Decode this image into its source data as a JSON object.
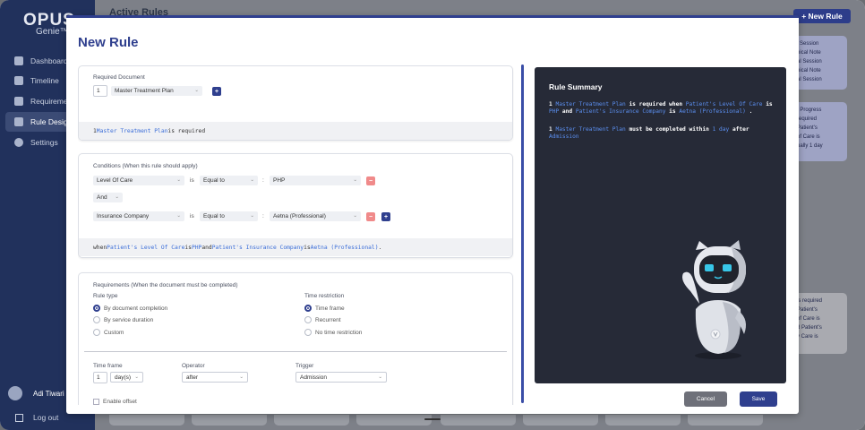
{
  "colors": {
    "accent": "#2f3f8e",
    "sidebar": "#21315c",
    "panel": "#262a37",
    "highlight": "#3a6dd8",
    "danger": "#f08a8a"
  },
  "sidebar": {
    "logo": "OPUS",
    "logo_sub": "Genie™",
    "items": [
      {
        "label": "Dashboard",
        "icon": "dashboard-icon"
      },
      {
        "label": "Timeline",
        "icon": "timeline-icon"
      },
      {
        "label": "Requirements",
        "icon": "requirements-icon"
      },
      {
        "label": "Rule Design",
        "icon": "rule-design-icon",
        "active": true
      },
      {
        "label": "Settings",
        "icon": "gear-icon"
      }
    ],
    "user": "Adi Tiwari",
    "logout": "Log out"
  },
  "background": {
    "page_title": "Active Rules",
    "new_rule_button": "+ New Rule",
    "card1": "l Session\nnical Note\nal Session\nnical Note\nal Session",
    "card2": "f Progress\nrequired\nPatient's\nof Care is\nually 1 day",
    "card3": "is required\nPatient's\nof Care is\nd Patient's\ny Care is"
  },
  "modal": {
    "title": "New Rule",
    "required_document": {
      "label": "Required Document",
      "quantity": "1",
      "document": "Master Treatment Plan",
      "add_button": "+",
      "summary": {
        "qty": "1",
        "doc": "Master Treatment Plan",
        "rest": "is required"
      }
    },
    "conditions": {
      "label": "Conditions (When this rule should apply)",
      "row1": {
        "field": "Level Of Care",
        "is": "is",
        "operator": "Equal to",
        "sep": ":",
        "value": "PHP",
        "remove": "−"
      },
      "joiner": "And",
      "row2": {
        "field": "Insurance Company",
        "is": "is",
        "operator": "Equal to",
        "sep": ":",
        "value": "Aetna (Professional)",
        "remove": "−",
        "add": "+"
      },
      "summary": {
        "when": "when",
        "f1": "Patient's Level Of Care",
        "is1": "is",
        "v1": "PHP",
        "and": "and",
        "f2": "Patient's Insurance Company",
        "is2": "is",
        "v2": "Aetna (Professional)",
        "end": "."
      }
    },
    "requirements": {
      "label": "Requirements (When the document must be completed)",
      "rule_type_label": "Rule type",
      "rule_types": [
        "By document completion",
        "By service duration",
        "Custom"
      ],
      "time_restriction_label": "Time restriction",
      "time_restrictions": [
        "Time frame",
        "Recurrent",
        "No time restriction"
      ],
      "time_frame_label": "Time frame",
      "time_frame_value": "1",
      "time_frame_unit": "day(s)",
      "operator_label": "Operator",
      "operator_value": "after",
      "trigger_label": "Trigger",
      "trigger_value": "Admission",
      "enable_offset": "Enable offset"
    },
    "summary_panel": {
      "title": "Rule Summary",
      "p1": {
        "qty": "1",
        "doc": "Master Treatment Plan",
        "is_required_when": "is required when",
        "f1": "Patient's Level Of Care",
        "is1": "is",
        "v1": "PHP",
        "and": "and",
        "f2": "Patient's Insurance Company",
        "is2": "is",
        "v2": "Aetna (Professional)",
        "end": "."
      },
      "p2": {
        "qty": "1",
        "doc": "Master Treatment Plan",
        "must": "must be completed within",
        "dur": "1 day",
        "after": "after",
        "trigger": "Admission"
      }
    },
    "cancel": "Cancel",
    "save": "Save"
  }
}
